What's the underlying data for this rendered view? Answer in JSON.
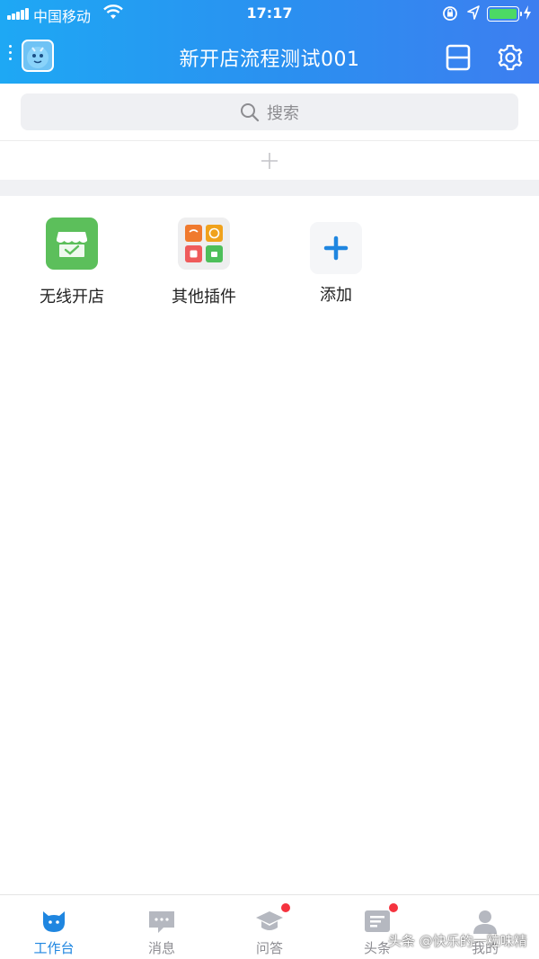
{
  "status_bar": {
    "carrier": "中国移动",
    "time": "17:17"
  },
  "nav": {
    "title": "新开店流程测试001"
  },
  "search": {
    "placeholder": "搜索"
  },
  "apps": [
    {
      "label": "无线开店",
      "icon": "storefront-icon",
      "color": "#5cbf5b"
    },
    {
      "label": "其他插件",
      "icon": "plugins-icon",
      "color": "#eeeeef"
    },
    {
      "label": "添加",
      "icon": "plus-icon",
      "color": "#1f86e0"
    }
  ],
  "tabs": [
    {
      "label": "工作台",
      "icon": "workbench-icon",
      "active": true
    },
    {
      "label": "消息",
      "icon": "message-icon"
    },
    {
      "label": "问答",
      "icon": "graduation-cap-icon",
      "badge": true
    },
    {
      "label": "头条",
      "icon": "news-icon",
      "badge": true
    },
    {
      "label": "我的",
      "icon": "profile-icon"
    }
  ],
  "colors": {
    "accent": "#1f86e0",
    "header_start": "#1ea8f4",
    "header_end": "#3d7ef0",
    "badge": "#f5333f"
  },
  "watermark": "头条 @快乐的一粒味精"
}
